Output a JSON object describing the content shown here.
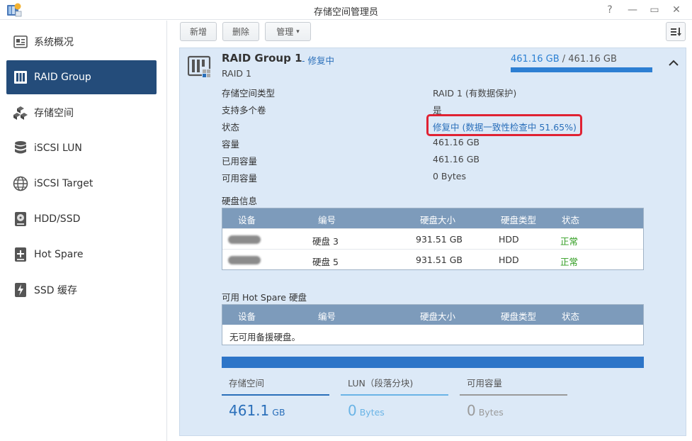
{
  "window": {
    "title": "存储空间管理员",
    "controls": [
      "?",
      "—",
      "▭",
      "✕"
    ]
  },
  "sidebar": {
    "items": [
      {
        "label": "系统概况",
        "icon": "overview-icon",
        "active": false
      },
      {
        "label": "RAID Group",
        "icon": "raid-group-icon",
        "active": true
      },
      {
        "label": "存储空间",
        "icon": "storage-cubes-icon",
        "active": false
      },
      {
        "label": "iSCSI LUN",
        "icon": "database-icon",
        "active": false
      },
      {
        "label": "iSCSI Target",
        "icon": "globe-icon",
        "active": false
      },
      {
        "label": "HDD/SSD",
        "icon": "hdd-icon",
        "active": false
      },
      {
        "label": "Hot Spare",
        "icon": "hot-spare-icon",
        "active": false
      },
      {
        "label": "SSD 缓存",
        "icon": "ssd-cache-icon",
        "active": false
      }
    ]
  },
  "toolbar": {
    "create": "新增",
    "delete": "删除",
    "manage": "管理",
    "manage_caret": "▾"
  },
  "raid": {
    "title": "RAID Group 1",
    "status_inline": "- 修复中",
    "subtitle": "RAID 1",
    "capacity_used": "461.16 GB",
    "capacity_sep": " / ",
    "capacity_total": "461.16 GB",
    "capacity_fraction": 1.0,
    "properties": [
      {
        "label": "存储空间类型",
        "value": "RAID 1 (有数据保护)"
      },
      {
        "label": "支持多个卷",
        "value": "是"
      },
      {
        "label": "状态",
        "value": "修复中 (数据一致性检查中 51.65%)"
      },
      {
        "label": "容量",
        "value": "461.16 GB"
      },
      {
        "label": "已用容量",
        "value": "461.16 GB"
      },
      {
        "label": "可用容量",
        "value": "0 Bytes"
      }
    ]
  },
  "disks": {
    "title": "硬盘信息",
    "columns": [
      "设备",
      "编号",
      "硬盘大小",
      "硬盘类型",
      "状态"
    ],
    "rows": [
      {
        "device": "",
        "number": "硬盘 3",
        "size": "931.51 GB",
        "type": "HDD",
        "status": "正常"
      },
      {
        "device": "",
        "number": "硬盘 5",
        "size": "931.51 GB",
        "type": "HDD",
        "status": "正常"
      }
    ]
  },
  "hot_spare": {
    "title": "可用 Hot Spare 硬盘",
    "columns": [
      "设备",
      "编号",
      "硬盘大小",
      "硬盘类型",
      "状态"
    ],
    "empty_text": "无可用备援硬盘。"
  },
  "usage": {
    "stats": [
      {
        "label": "存储空间",
        "value": "461.1",
        "unit": "GB",
        "color": "#2a6fba"
      },
      {
        "label": "LUN（段落分块)",
        "value": "0",
        "unit": "Bytes",
        "color": "#6ab4e6"
      },
      {
        "label": "可用容量",
        "value": "0",
        "unit": "Bytes",
        "color": "#9a9a9a"
      }
    ]
  },
  "colors": {
    "accent": "#244c7a",
    "link": "#2a6fba",
    "ok": "#2f9c1f",
    "highlight": "#e02233",
    "panel": "#dce9f7"
  }
}
